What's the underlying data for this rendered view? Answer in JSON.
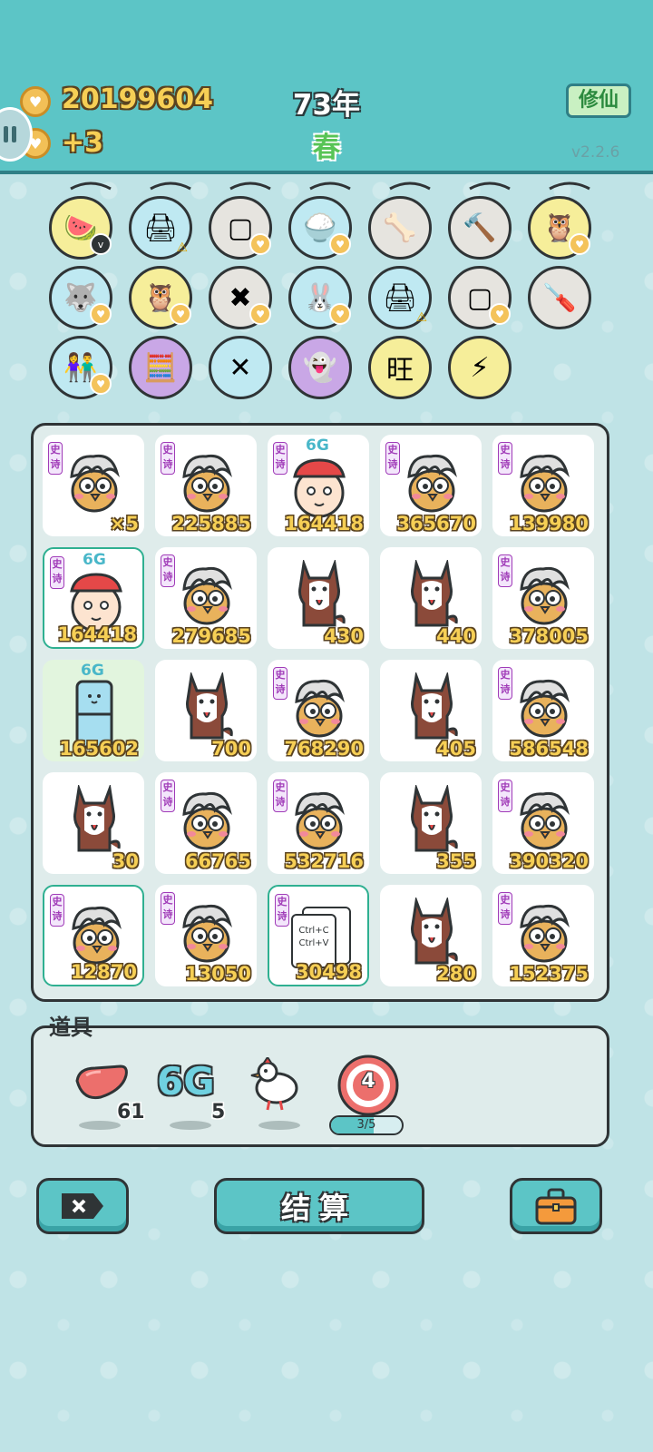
{
  "header": {
    "gold_amount": "20199604",
    "gold_income": "+3",
    "year": "73年",
    "season": "春",
    "xiuxian_label": "修仙",
    "version": "v2.2.6"
  },
  "tools": [
    {
      "name": "fruit-basket-icon",
      "glyph": "🍉",
      "bg": "#f6ee9a",
      "badge": "v"
    },
    {
      "name": "printer-icon",
      "glyph": "🖨",
      "bg": "#bfe9f2",
      "badge": "warn"
    },
    {
      "name": "sugar-cubes-icon",
      "glyph": "▢",
      "bg": "#e6e4df",
      "badge": "heart"
    },
    {
      "name": "rice-bowl-icon",
      "glyph": "🍚",
      "bg": "#bfe9f2",
      "badge": "heart"
    },
    {
      "name": "dog-bowl-icon",
      "glyph": "🦴",
      "bg": "#e6e4df",
      "badge": ""
    },
    {
      "name": "hammer-icon",
      "glyph": "🔨",
      "bg": "#e6e4df",
      "badge": ""
    },
    {
      "name": "owls-icon",
      "glyph": "🦉",
      "bg": "#f6ee9a",
      "badge": "heart"
    },
    {
      "name": "husky-icon",
      "glyph": "🐺",
      "bg": "#bfe9f2",
      "badge": "heart"
    },
    {
      "name": "owls-icon-2",
      "glyph": "🦉",
      "bg": "#f6ee9a",
      "badge": "heart"
    },
    {
      "name": "delete-tag-icon",
      "glyph": "✖",
      "bg": "#e6e4df",
      "badge": "heart"
    },
    {
      "name": "rabbit-icon",
      "glyph": "🐰",
      "bg": "#bfe9f2",
      "badge": "heart"
    },
    {
      "name": "printer-icon-2",
      "glyph": "🖨",
      "bg": "#bfe9f2",
      "badge": "warn"
    },
    {
      "name": "sugar-cubes-icon-2",
      "glyph": "▢",
      "bg": "#e6e4df",
      "badge": "heart"
    },
    {
      "name": "screwdriver-icon",
      "glyph": "🪛",
      "bg": "#e6e4df",
      "badge": ""
    },
    {
      "name": "couple-icon",
      "glyph": "👫",
      "bg": "#bfe9f2",
      "badge": "heart"
    },
    {
      "name": "math-head-icon",
      "glyph": "🧮",
      "bg": "#c9a7e6",
      "badge": ""
    },
    {
      "name": "chopsticks-icon",
      "glyph": "✕",
      "bg": "#bfe9f2",
      "badge": ""
    },
    {
      "name": "ghost-icon",
      "glyph": "👻",
      "bg": "#c9a7e6",
      "badge": ""
    },
    {
      "name": "wang-tiles-icon",
      "glyph": "旺",
      "bg": "#f6ee9a",
      "badge": ""
    },
    {
      "name": "lightning-icon",
      "glyph": "⚡",
      "bg": "#f6ee9a",
      "badge": ""
    }
  ],
  "grid": [
    {
      "type": "chick",
      "tag": "史诗",
      "value": "×5"
    },
    {
      "type": "chick",
      "tag": "史诗",
      "value": "225885"
    },
    {
      "type": "redhat",
      "tag": "史诗",
      "sixg": "6G",
      "value": "164418"
    },
    {
      "type": "chick",
      "tag": "史诗",
      "value": "365670"
    },
    {
      "type": "chick",
      "tag": "史诗",
      "value": "139980"
    },
    {
      "type": "redhat",
      "tag": "史诗",
      "sixg": "6G",
      "value": "164418",
      "hl": true
    },
    {
      "type": "chick",
      "tag": "史诗",
      "value": "279685"
    },
    {
      "type": "dog",
      "value": "430"
    },
    {
      "type": "dog",
      "value": "440"
    },
    {
      "type": "chick",
      "tag": "史诗",
      "value": "378005"
    },
    {
      "type": "fridge",
      "sixg": "6G",
      "value": "165602",
      "green": true
    },
    {
      "type": "dog",
      "value": "700"
    },
    {
      "type": "chick",
      "tag": "史诗",
      "value": "768290"
    },
    {
      "type": "dog",
      "value": "405"
    },
    {
      "type": "chick",
      "tag": "史诗",
      "value": "586548"
    },
    {
      "type": "dog",
      "value": "30"
    },
    {
      "type": "chick",
      "tag": "史诗",
      "value": "66765"
    },
    {
      "type": "chick",
      "tag": "史诗",
      "value": "532716"
    },
    {
      "type": "dog",
      "value": "355"
    },
    {
      "type": "chick",
      "tag": "史诗",
      "value": "390320"
    },
    {
      "type": "chick",
      "tag": "史诗",
      "value": "12870",
      "hl": true
    },
    {
      "type": "chick",
      "tag": "史诗",
      "value": "13050"
    },
    {
      "type": "copypaste",
      "tag": "史诗",
      "value": "30498",
      "hl": true,
      "copy_label": "Ctrl+C",
      "paste_label": "Ctrl+V"
    },
    {
      "type": "dog",
      "value": "280"
    },
    {
      "type": "chick",
      "tag": "史诗",
      "value": "152375"
    }
  ],
  "items": {
    "title": "道具",
    "liver_count": "61",
    "sixg_label": "6G",
    "sixg_count": "5",
    "target_number": "4",
    "target_progress_text": "3/5",
    "target_progress": 0.6
  },
  "buttons": {
    "settle_label": "结算"
  },
  "colors": {
    "header_bg": "#5cc5c6",
    "accent_gold": "#f6cf55",
    "epic_purple": "#a03bb8",
    "sixg_blue": "#49b7c9"
  }
}
